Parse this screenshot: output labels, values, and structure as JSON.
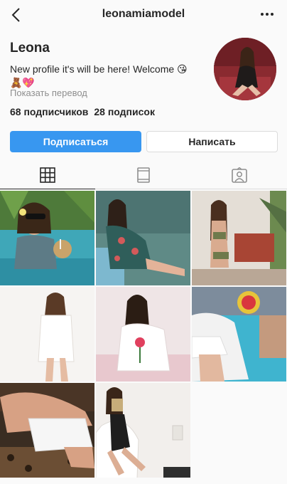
{
  "header": {
    "username": "leonamiamodel",
    "back_icon": "chevron-left-icon",
    "more_icon": "more-horizontal-icon"
  },
  "profile": {
    "name": "Leona",
    "bio_line1": "New profile it's will be here! Welcome 😘",
    "bio_line2": "🧸💖",
    "translate_link": "Показать перевод",
    "followers": "68 подписчиков",
    "following": "28 подписок"
  },
  "actions": {
    "follow_label": "Подписаться",
    "message_label": "Написать"
  },
  "tabs": [
    {
      "name": "grid",
      "icon": "grid-icon",
      "active": true
    },
    {
      "name": "igtv",
      "icon": "igtv-icon",
      "active": false
    },
    {
      "name": "tagged",
      "icon": "tagged-person-icon",
      "active": false
    }
  ],
  "colors": {
    "accent": "#3897f0",
    "text": "#262626",
    "muted": "#8e8e8e",
    "border": "#dbdbdb"
  },
  "posts_count_visible": 8
}
